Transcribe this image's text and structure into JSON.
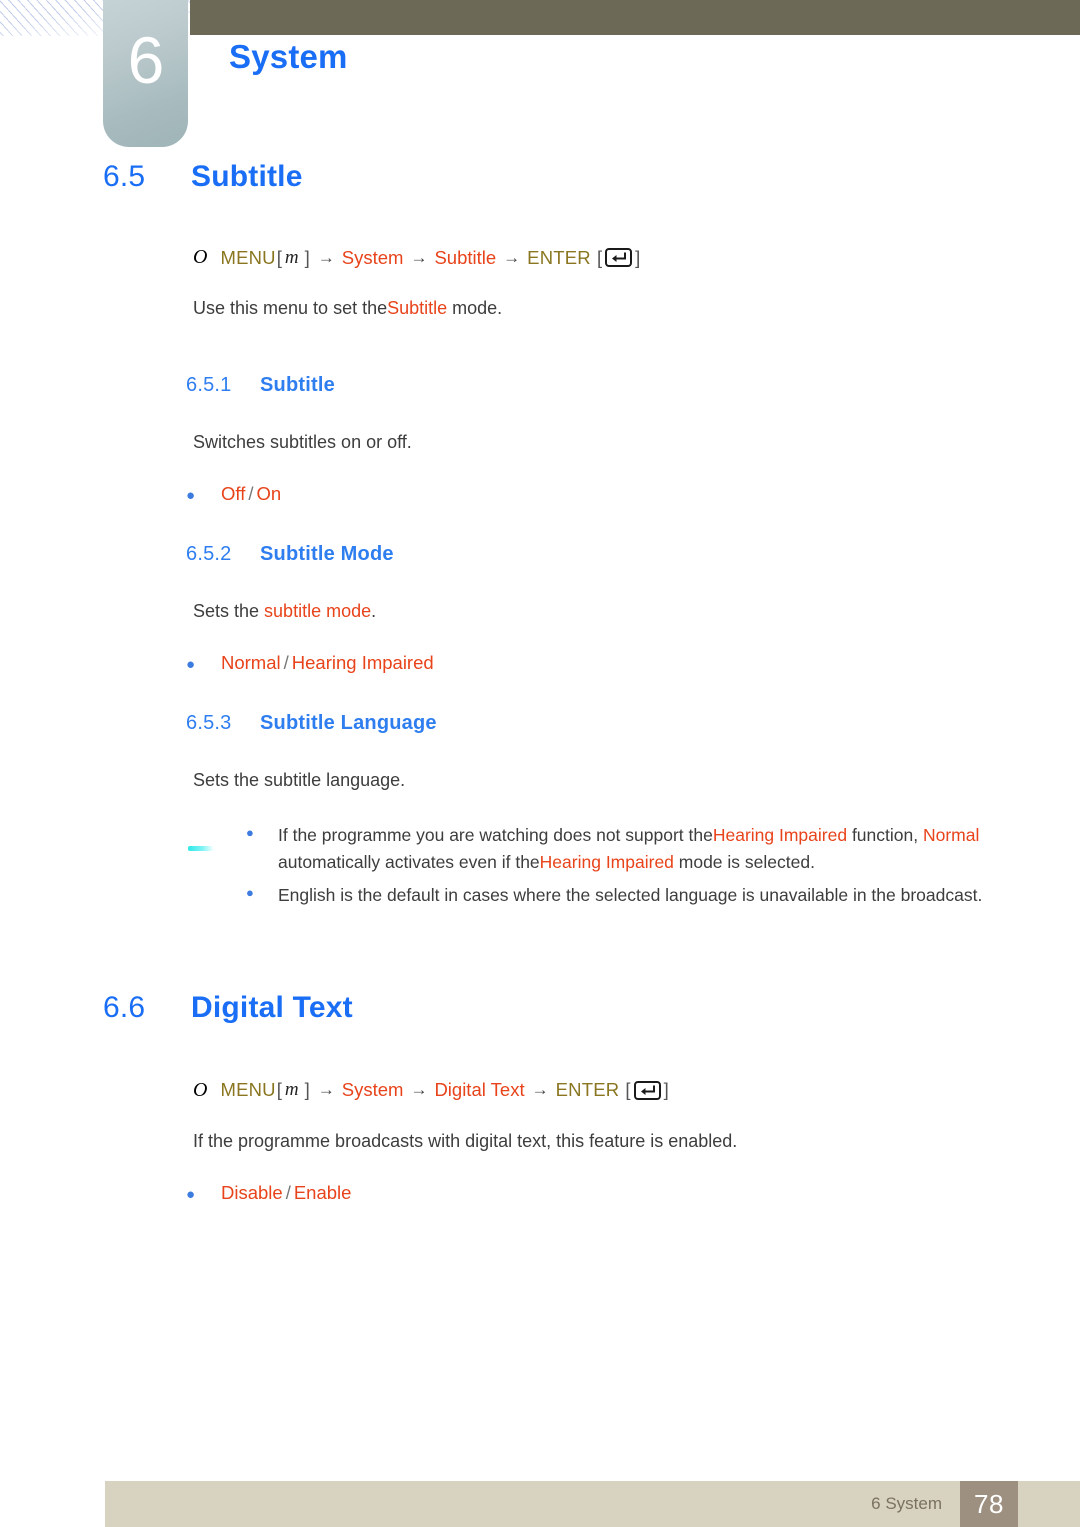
{
  "header": {
    "chapter_number": "6",
    "chapter_title": "System"
  },
  "sections": [
    {
      "number": "6.5",
      "title": "Subtitle",
      "menu_path": {
        "bullet": "O",
        "menu_label": "MENU",
        "open_bracket": "[",
        "key": "m",
        "close_bracket": "]",
        "arrow": "→",
        "step1": "System",
        "step2": "Subtitle",
        "enter_label": "ENTER",
        "enter_icon": "enter-key-icon"
      },
      "intro_before": "Use this menu to set the",
      "intro_highlight": "Subtitle",
      "intro_after": " mode.",
      "subsections": [
        {
          "number": "6.5.1",
          "title": "Subtitle",
          "description": "Switches subtitles on or off.",
          "options": [
            {
              "first": "Off",
              "sep": "/",
              "second": "On"
            }
          ]
        },
        {
          "number": "6.5.2",
          "title": "Subtitle Mode",
          "desc_before": "Sets the ",
          "desc_highlight": "subtitle mode",
          "desc_after": ".",
          "options": [
            {
              "first": "Normal",
              "sep": "/",
              "second": "Hearing Impaired"
            }
          ]
        },
        {
          "number": "6.5.3",
          "title": "Subtitle Language",
          "description": "Sets the subtitle language.",
          "notes": [
            {
              "p1": "If the programme you are watching does not support the",
              "h1": "Hearing Impaired",
              "p2": " function, ",
              "h2": "Normal",
              "p3": " automatically activates even if the",
              "h3": "Hearing Impaired",
              "p4": " mode is selected."
            },
            {
              "p1": "English is the default in cases where the selected language is unavailable in the broadcast."
            }
          ]
        }
      ]
    },
    {
      "number": "6.6",
      "title": "Digital Text",
      "menu_path": {
        "bullet": "O",
        "menu_label": "MENU",
        "open_bracket": "[",
        "key": "m",
        "close_bracket": "]",
        "arrow": "→",
        "step1": "System",
        "step2": "Digital Text",
        "enter_label": "ENTER",
        "enter_icon": "enter-key-icon"
      },
      "description": "If the programme broadcasts with digital text, this feature is enabled.",
      "options": [
        {
          "first": "Disable",
          "sep": "/",
          "second": "Enable"
        }
      ]
    }
  ],
  "footer": {
    "label": "6 System",
    "page_number": "78"
  },
  "colors": {
    "heading_blue": "#1a6ef5",
    "menu_orange": "#e8431a",
    "menu_gold": "#8a7620",
    "olive_bar": "#6c6a57",
    "footer_bar": "#d8d2c0",
    "page_box": "#9e9081",
    "bullet_blue": "#3c7be0",
    "note_marker_cyan": "#2fe8e8"
  }
}
